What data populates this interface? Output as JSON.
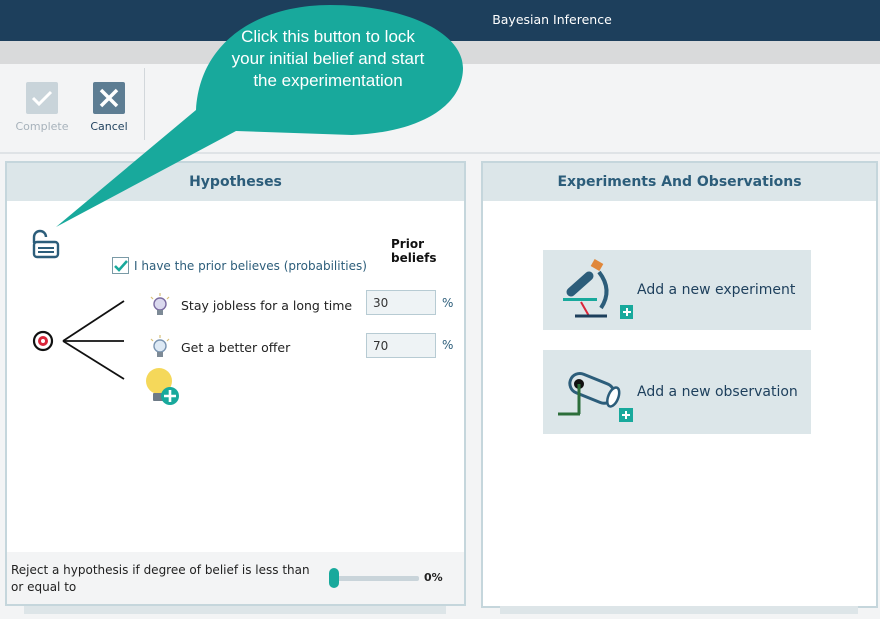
{
  "window": {
    "title": "Bayesian Inference"
  },
  "toolbar": {
    "complete_label": "Complete",
    "cancel_label": "Cancel"
  },
  "hypotheses": {
    "title": "Hypotheses",
    "prior_beliefs_label": "Prior beliefs",
    "checkbox_label": "I have the prior believes (probabilities)",
    "checkbox_checked": true,
    "items": [
      {
        "name": "Stay jobless for a long time",
        "value": "30",
        "unit": "%"
      },
      {
        "name": "Get a better offer",
        "value": "70",
        "unit": "%"
      }
    ],
    "reject_label": "Reject a hypothesis if degree of belief is less than or equal to",
    "reject_value": "0%",
    "reject_fraction": 0
  },
  "experiments": {
    "title": "Experiments And Observations",
    "add_experiment_label": "Add a new experiment",
    "add_observation_label": "Add a new observation"
  },
  "callout": {
    "text": "Click this button to lock your initial belief and start the experimentation"
  },
  "colors": {
    "titlebar": "#1d3f5c",
    "accent": "#18a99c",
    "panel_header": "#dce6e9",
    "header_text": "#2c5d7a"
  },
  "icons": [
    "check-icon",
    "close-icon",
    "lock-icon",
    "target-icon",
    "lightbulb-icon",
    "add-lightbulb-icon",
    "microscope-icon",
    "magnifier-icon"
  ]
}
